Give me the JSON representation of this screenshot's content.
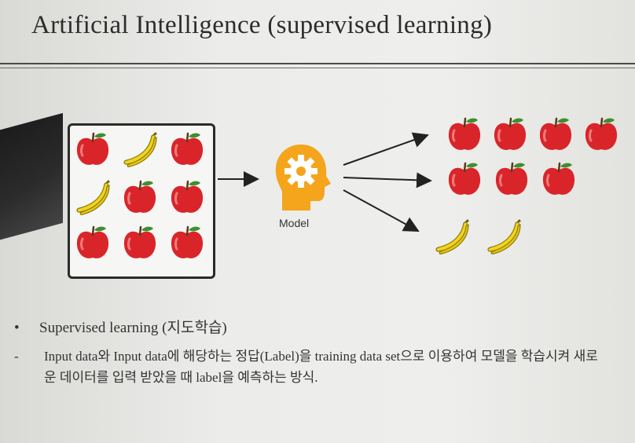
{
  "slide": {
    "title": "Artificial Intelligence (supervised learning)"
  },
  "diagram": {
    "model_label": "Model",
    "input_fruits": [
      "apple",
      "banana",
      "apple",
      "banana",
      "apple",
      "apple",
      "apple",
      "apple",
      "apple"
    ],
    "output_rows": [
      [
        "apple",
        "apple",
        "apple",
        "apple"
      ],
      [
        "apple",
        "apple",
        "apple"
      ],
      [
        "banana",
        "banana"
      ]
    ],
    "colors": {
      "apple": "#d9252a",
      "banana": "#f2d51c",
      "model": "#f4a51c"
    }
  },
  "bullets": {
    "item1_marker": "•",
    "item1": "Supervised learning (지도학습)",
    "item2_marker": "-",
    "item2": "Input data와 Input data에 해당하는 정답(Label)을 training data set으로 이용하여 모델을 학습시켜 새로운 데이터를 입력 받았을 때 label을 예측하는 방식."
  }
}
